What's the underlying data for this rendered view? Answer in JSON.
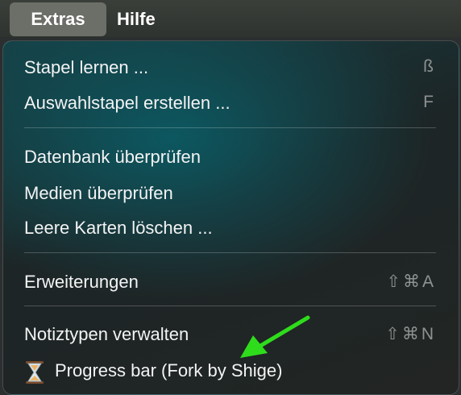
{
  "menubar": {
    "items": [
      {
        "label": "Extras"
      },
      {
        "label": "Hilfe"
      }
    ]
  },
  "menu": {
    "items": [
      {
        "label": "Stapel lernen ...",
        "shortcut": "ß"
      },
      {
        "label": "Auswahlstapel erstellen ...",
        "shortcut": "F"
      },
      {
        "label": "Datenbank überprüfen",
        "shortcut": ""
      },
      {
        "label": "Medien überprüfen",
        "shortcut": ""
      },
      {
        "label": "Leere Karten löschen ...",
        "shortcut": ""
      },
      {
        "label": "Erweiterungen",
        "shortcut": "⇧⌘A"
      },
      {
        "label": "Notiztypen verwalten",
        "shortcut": "⇧⌘N"
      },
      {
        "label": "Progress bar (Fork by Shige)",
        "shortcut": "",
        "icon": "hourglass-icon"
      }
    ]
  },
  "annotation": {
    "arrow_color": "#2fdc1c",
    "arrow_icon": "green-arrow-annotation"
  }
}
